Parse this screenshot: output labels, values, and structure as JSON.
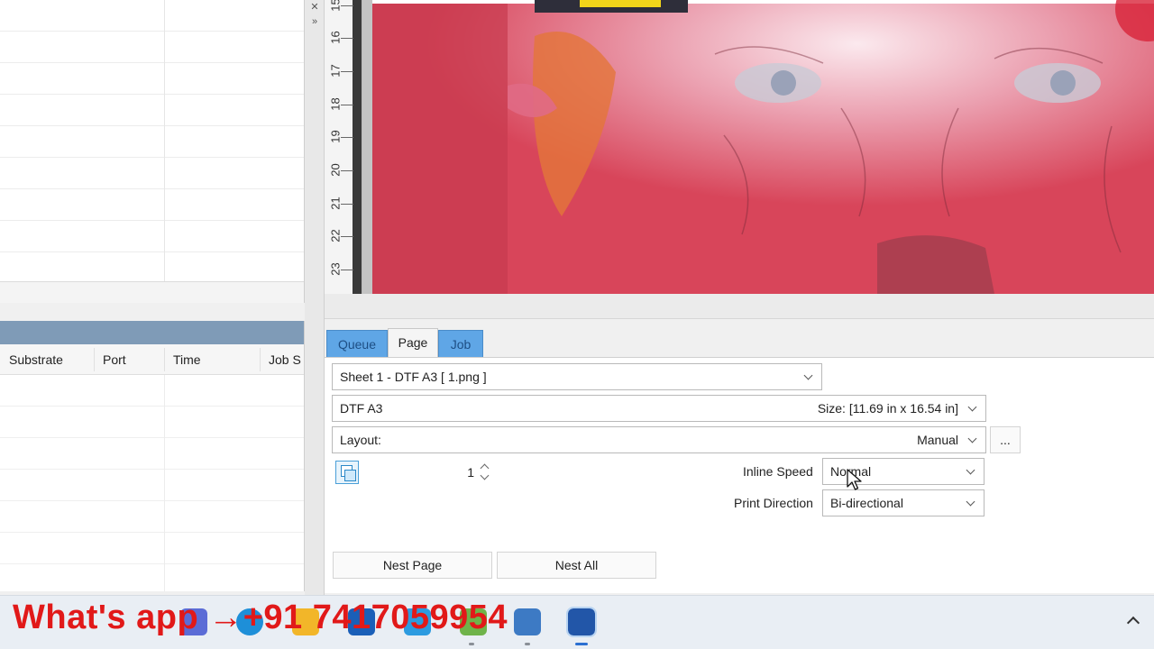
{
  "job_table": {
    "columns": [
      "Substrate",
      "Port",
      "Time",
      "Job S"
    ]
  },
  "ruler": {
    "labels": [
      "15",
      "16",
      "17",
      "18",
      "19",
      "20",
      "21",
      "22",
      "23"
    ]
  },
  "tabs": {
    "queue": "Queue",
    "page": "Page",
    "job": "Job",
    "active": "Page"
  },
  "page_panel": {
    "sheet_select": "Sheet 1 - DTF A3 [ 1.png ]",
    "media_name": "DTF A3",
    "media_size": "Size: [11.69 in x 16.54 in]",
    "layout_label": "Layout:",
    "layout_value": "Manual",
    "more_button": "...",
    "copies_value": "1",
    "inline_speed_label": "Inline Speed",
    "inline_speed_value": "Normal",
    "print_direction_label": "Print Direction",
    "print_direction_value": "Bi-directional",
    "nest_page_button": "Nest Page",
    "nest_all_button": "Nest All"
  },
  "banner": {
    "text": "What's app →+91 7417059954",
    "color": "#e11919"
  },
  "colors": {
    "tab_inactive": "#5fa6e6",
    "panel_title": "#7f9bb7",
    "artwork_pink": "#d8455a"
  },
  "icons": {
    "splitter_top": "close-icon",
    "splitter_collapse": "double-chevron-right-icon",
    "copies": "copies-icon",
    "tray": "chevron-up-icon"
  }
}
